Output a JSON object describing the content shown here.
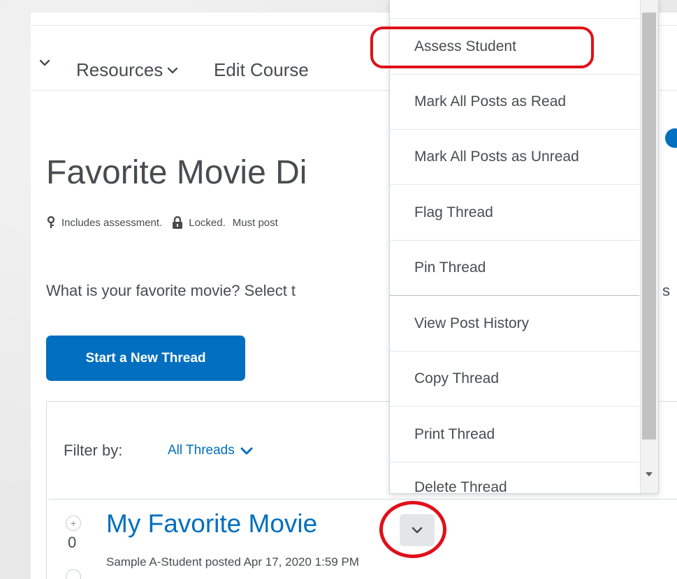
{
  "nav": {
    "resources_label": "Resources",
    "edit_course_label": "Edit Course"
  },
  "topic": {
    "title": "Favorite Movie Di",
    "meta_assessment": "Includes assessment.",
    "meta_locked": "Locked.",
    "meta_must_post": "Must post",
    "description": "What is your favorite movie?  Select t",
    "description_tail": "s"
  },
  "actions": {
    "start_thread_label": "Start a New Thread"
  },
  "filter": {
    "label": "Filter by:",
    "value": "All Threads"
  },
  "thread": {
    "vote_plus": "+",
    "vote_count": "0",
    "title": "My Favorite Movie",
    "posted_by": "Sample A-Student posted Apr 17, 2020 1:59 PM"
  },
  "menu": {
    "items": [
      {
        "label": "Assess Student"
      },
      {
        "label": "Mark All Posts as Read"
      },
      {
        "label": "Mark All Posts as Unread"
      },
      {
        "label": "Flag Thread"
      },
      {
        "label": "Pin Thread"
      },
      {
        "label": "View Post History"
      },
      {
        "label": "Copy Thread"
      },
      {
        "label": "Print Thread"
      },
      {
        "label": "Delete Thread"
      }
    ]
  },
  "colors": {
    "brand_blue": "#006fbf",
    "annotation_red": "#e0101a",
    "text": "#494c4e"
  },
  "icons": [
    "chevron-down-icon",
    "key-icon",
    "lock-icon",
    "help-icon",
    "scroll-down-arrow-icon"
  ]
}
